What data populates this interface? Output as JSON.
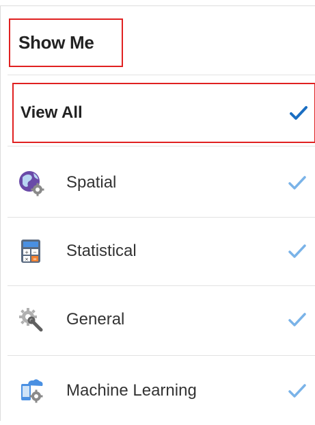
{
  "panel": {
    "title": "Show Me"
  },
  "view_all": {
    "label": "View All",
    "checked": true,
    "check_color": "#1a6ec2"
  },
  "items": [
    {
      "label": "Spatial",
      "icon": "globe-gear-icon",
      "checked": true
    },
    {
      "label": "Statistical",
      "icon": "calculator-icon",
      "checked": true
    },
    {
      "label": "General",
      "icon": "gear-wrench-icon",
      "checked": true
    },
    {
      "label": "Machine Learning",
      "icon": "cloud-device-gear-icon",
      "checked": true
    }
  ],
  "colors": {
    "highlight_border": "#e02020",
    "check_light": "#7ab3e8",
    "check_dark": "#1a6ec2"
  }
}
